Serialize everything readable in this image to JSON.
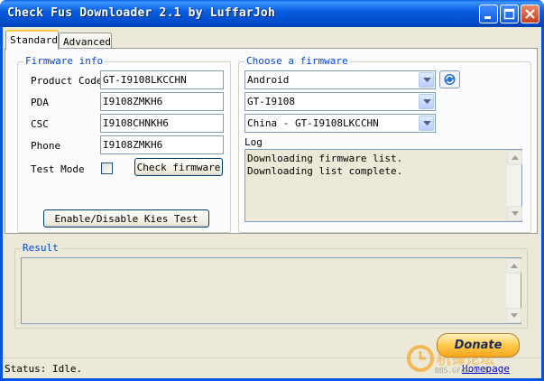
{
  "window": {
    "title": "Check Fus Downloader 2.1 by LuffarJoh"
  },
  "tabs": [
    {
      "label": "Standard"
    },
    {
      "label": "Advanced"
    }
  ],
  "firmware_info": {
    "title": "Firmware info",
    "product_code": {
      "label": "Product Code",
      "value": "GT-I9108LKCCHN"
    },
    "pda": {
      "label": "PDA",
      "value": "I9108ZMKH6"
    },
    "csc": {
      "label": "CSC",
      "value": "I9108CHNKH6"
    },
    "phone": {
      "label": "Phone",
      "value": "I9108ZMKH6"
    },
    "test_mode_label": "Test Mode",
    "check_firmware_label": "Check firmware",
    "kies_label": "Enable/Disable Kies Test"
  },
  "choose_firmware": {
    "title": "Choose a firmware",
    "os": "Android",
    "model": "GT-I9108",
    "region": "China - GT-I9108LKCCHN",
    "log_label": "Log",
    "log_lines": [
      "Downloading firmware list.",
      "Downloading list complete."
    ]
  },
  "result": {
    "title": "Result"
  },
  "donate_label": "Donate",
  "status": {
    "text": "Status: Idle."
  },
  "homepage_label": "Homepage",
  "watermark": "BBS.GFAN.COM",
  "colors": {
    "titlebar": "#0054e3",
    "group_title": "#0046d5",
    "client": "#ece9d8"
  }
}
